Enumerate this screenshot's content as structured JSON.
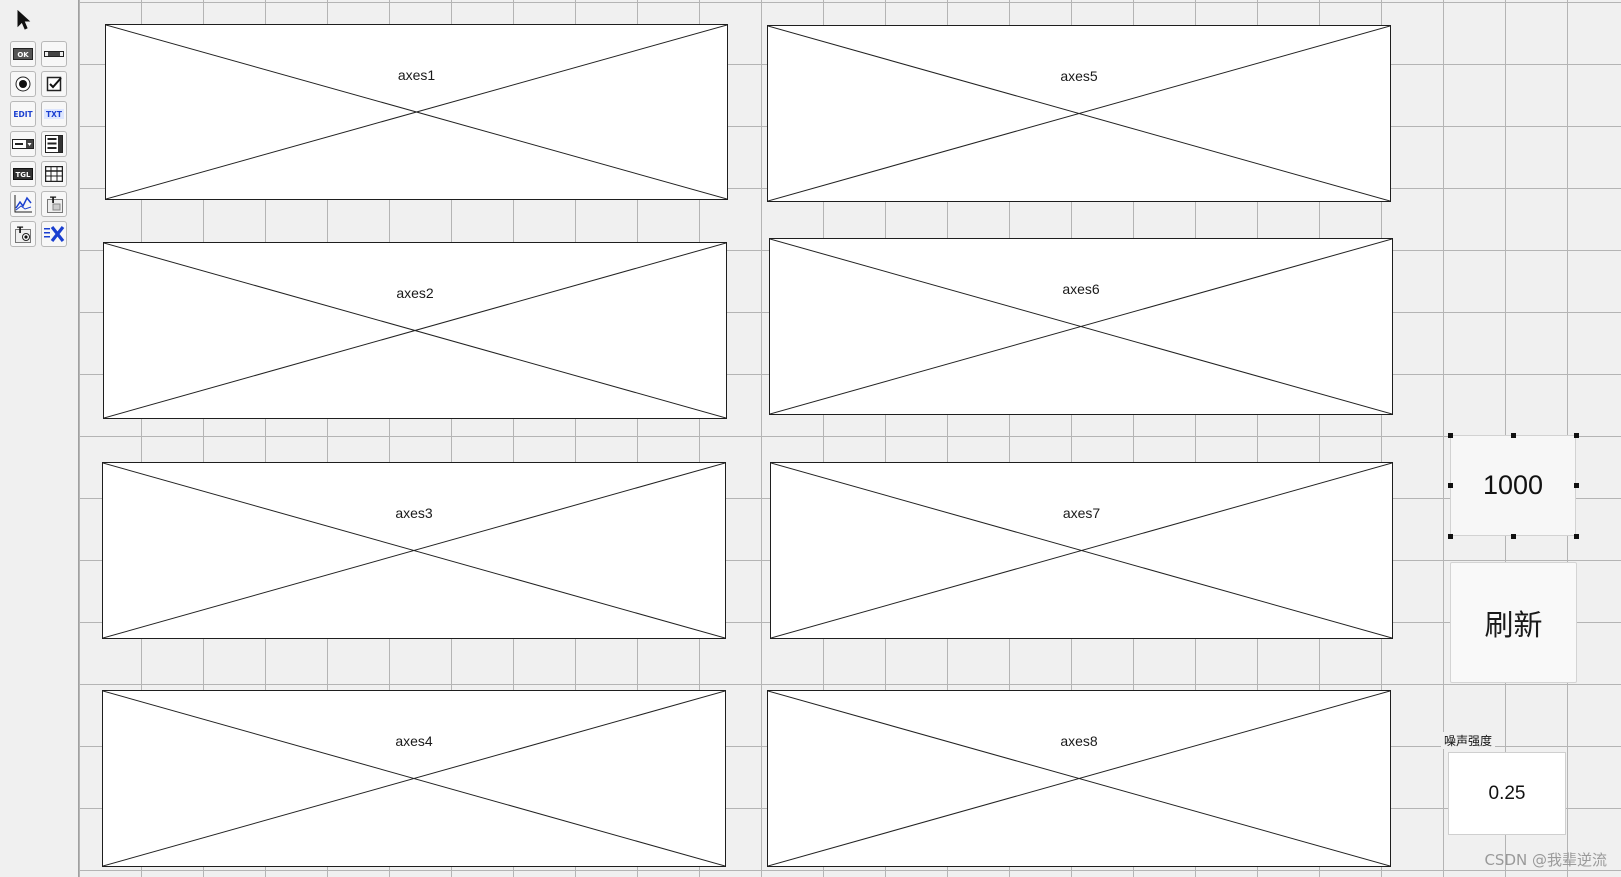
{
  "palette": {
    "tools": [
      {
        "name": "pushbutton",
        "label": "OK"
      },
      {
        "name": "slider",
        "label": ""
      },
      {
        "name": "radiobutton",
        "label": ""
      },
      {
        "name": "checkbox",
        "label": ""
      },
      {
        "name": "edit-text",
        "label": "EDIT"
      },
      {
        "name": "static-text",
        "label": "TXT"
      },
      {
        "name": "popup-menu",
        "label": ""
      },
      {
        "name": "listbox",
        "label": ""
      },
      {
        "name": "toggle-button",
        "label": "TGL"
      },
      {
        "name": "table",
        "label": ""
      },
      {
        "name": "axes",
        "label": ""
      },
      {
        "name": "panel",
        "label": ""
      },
      {
        "name": "button-group",
        "label": ""
      },
      {
        "name": "activex",
        "label": ""
      }
    ]
  },
  "axes": [
    {
      "label": "axes1"
    },
    {
      "label": "axes2"
    },
    {
      "label": "axes3"
    },
    {
      "label": "axes4"
    },
    {
      "label": "axes5"
    },
    {
      "label": "axes6"
    },
    {
      "label": "axes7"
    },
    {
      "label": "axes8"
    }
  ],
  "controls": {
    "count_value": "1000",
    "refresh_label": "刷新",
    "noise_label": "噪声强度",
    "noise_value": "0.25"
  },
  "watermark": "CSDN @我辈逆流",
  "colors": {
    "background": "#f0f0f0",
    "grid": "#b4b4b4",
    "axes_border": "#1e1e1e"
  }
}
